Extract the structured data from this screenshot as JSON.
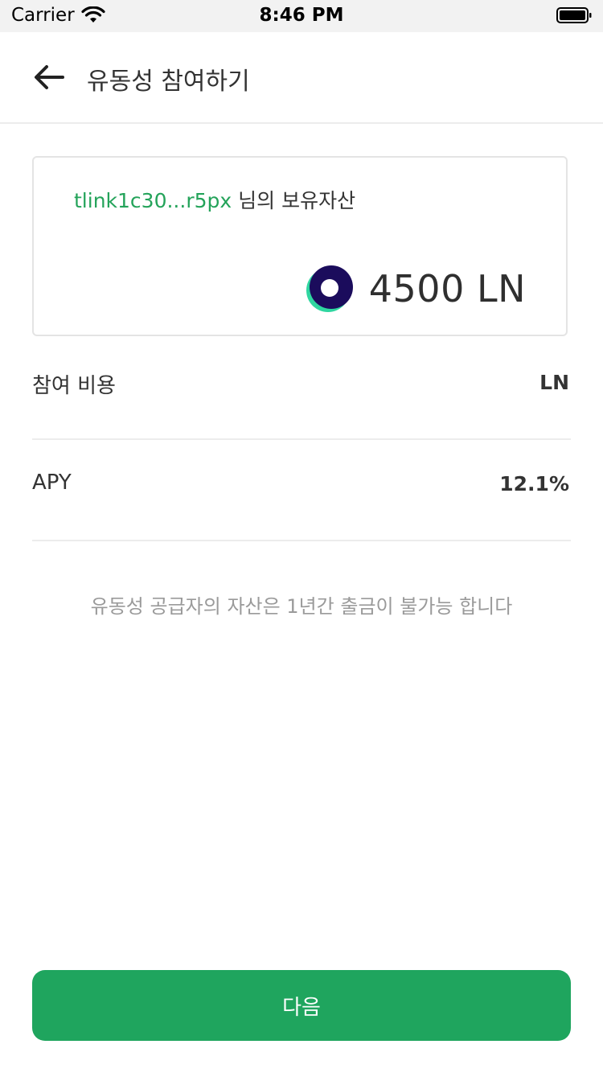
{
  "status_bar": {
    "carrier": "Carrier",
    "time": "8:46 PM",
    "icons": [
      "wifi-icon",
      "battery-icon"
    ]
  },
  "header": {
    "back_icon": "arrow-left-icon",
    "title": "유동성 참여하기"
  },
  "holdings_card": {
    "address": "tlink1c30...r5px",
    "owner_suffix": " 님의 보유자산",
    "token_icon": "ln-token-logo",
    "amount": "4500 LN"
  },
  "rows": {
    "fee": {
      "label": "참여 비용",
      "value": "LN"
    },
    "apy": {
      "label": "APY",
      "value": "12.1%"
    }
  },
  "notice": "유동성 공급자의 자산은 1년간 출금이 불가능 합니다",
  "next_button": {
    "label": "다음"
  },
  "colors": {
    "accent": "#1fa55e",
    "address": "#24a35a",
    "notice": "#9a9a9a",
    "logo_dark": "#1b0c5c",
    "logo_light": "#2fd6a0"
  }
}
